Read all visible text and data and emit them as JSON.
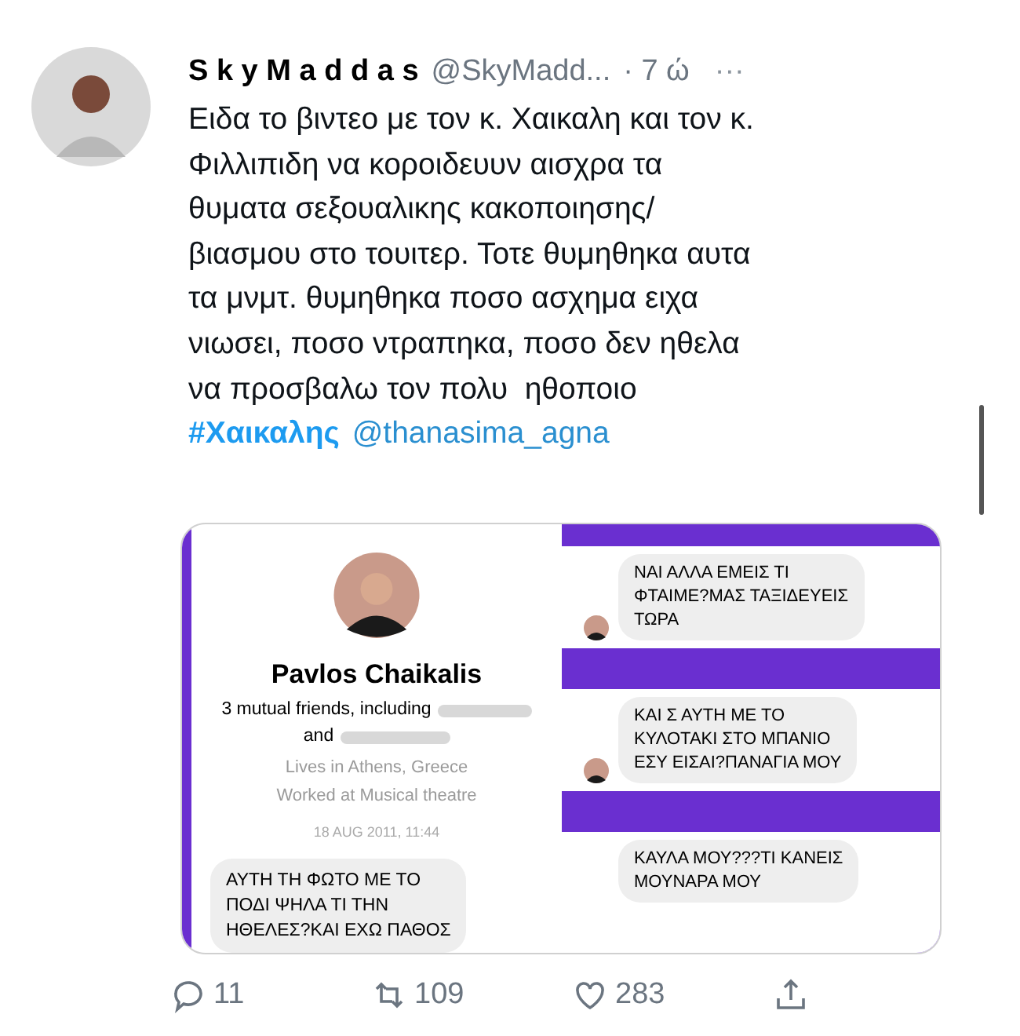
{
  "tweet": {
    "display_name": "S k y M a d d a s",
    "handle": "@SkyMadd...",
    "time": "· 7 ώ",
    "more": "···",
    "text": "Ειδα το βιντεο με τον κ. Χαικαλη και τον κ.\nΦιλλιπιδη να κοροιδευυν αισχρα τα\nθυματα σεξουαλικης κακοποιησης/\nβιασμου στο τουιτερ. Τοτε θυμηθηκα αυτα\nτα μνμτ. θυμηθηκα ποσο ασχημα ειχα\nνιωσει, ποσο ντραπηκα, ποσο δεν ηθελα\nνα προσβαλω τον πολυ  ηθοποιο",
    "hashtag": "#Χαικαλης",
    "mention": "@thanasima_agna"
  },
  "attachment": {
    "profile": {
      "name": "Pavlos Chaikalis",
      "mutual": "3 mutual friends, including",
      "and": "and",
      "lives": "Lives in Athens, Greece",
      "worked": "Worked at Musical theatre",
      "date": "18 AUG 2011, 11:44"
    },
    "left_message": "ΑΥΤΗ ΤΗ ΦΩΤΟ ΜΕ ΤΟ\nΠΟΔΙ ΨΗΛΑ ΤΙ ΤΗΝ\nΗΘΕΛΕΣ?ΚΑΙ ΕΧΩ ΠΑΘΟΣ",
    "right_messages": [
      {
        "text": "ΝΑΙ ΑΛΛΑ ΕΜΕΙΣ ΤΙ\nΦΤΑΙΜΕ?ΜΑΣ ΤΑΞΙΔΕΥΕΙΣ\nΤΩΡΑ",
        "avatar": true
      },
      {
        "text": "ΚΑΙ Σ ΑΥΤΗ ΜΕ ΤΟ\nΚΥΛΟΤΑΚΙ ΣΤΟ ΜΠΑΝΙΟ\nΕΣΥ ΕΙΣΑΙ?ΠΑΝΑΓΙΑ ΜΟΥ",
        "avatar": true
      },
      {
        "text": "ΚΑΥΛΑ ΜΟΥ???ΤΙ ΚΑΝΕΙΣ\nΜΟΥΝΑΡΑ ΜΟΥ",
        "avatar": false
      }
    ]
  },
  "actions": [
    {
      "kind": "reply",
      "count": "11"
    },
    {
      "kind": "retweet",
      "count": "109"
    },
    {
      "kind": "like",
      "count": "283"
    },
    {
      "kind": "share"
    }
  ]
}
